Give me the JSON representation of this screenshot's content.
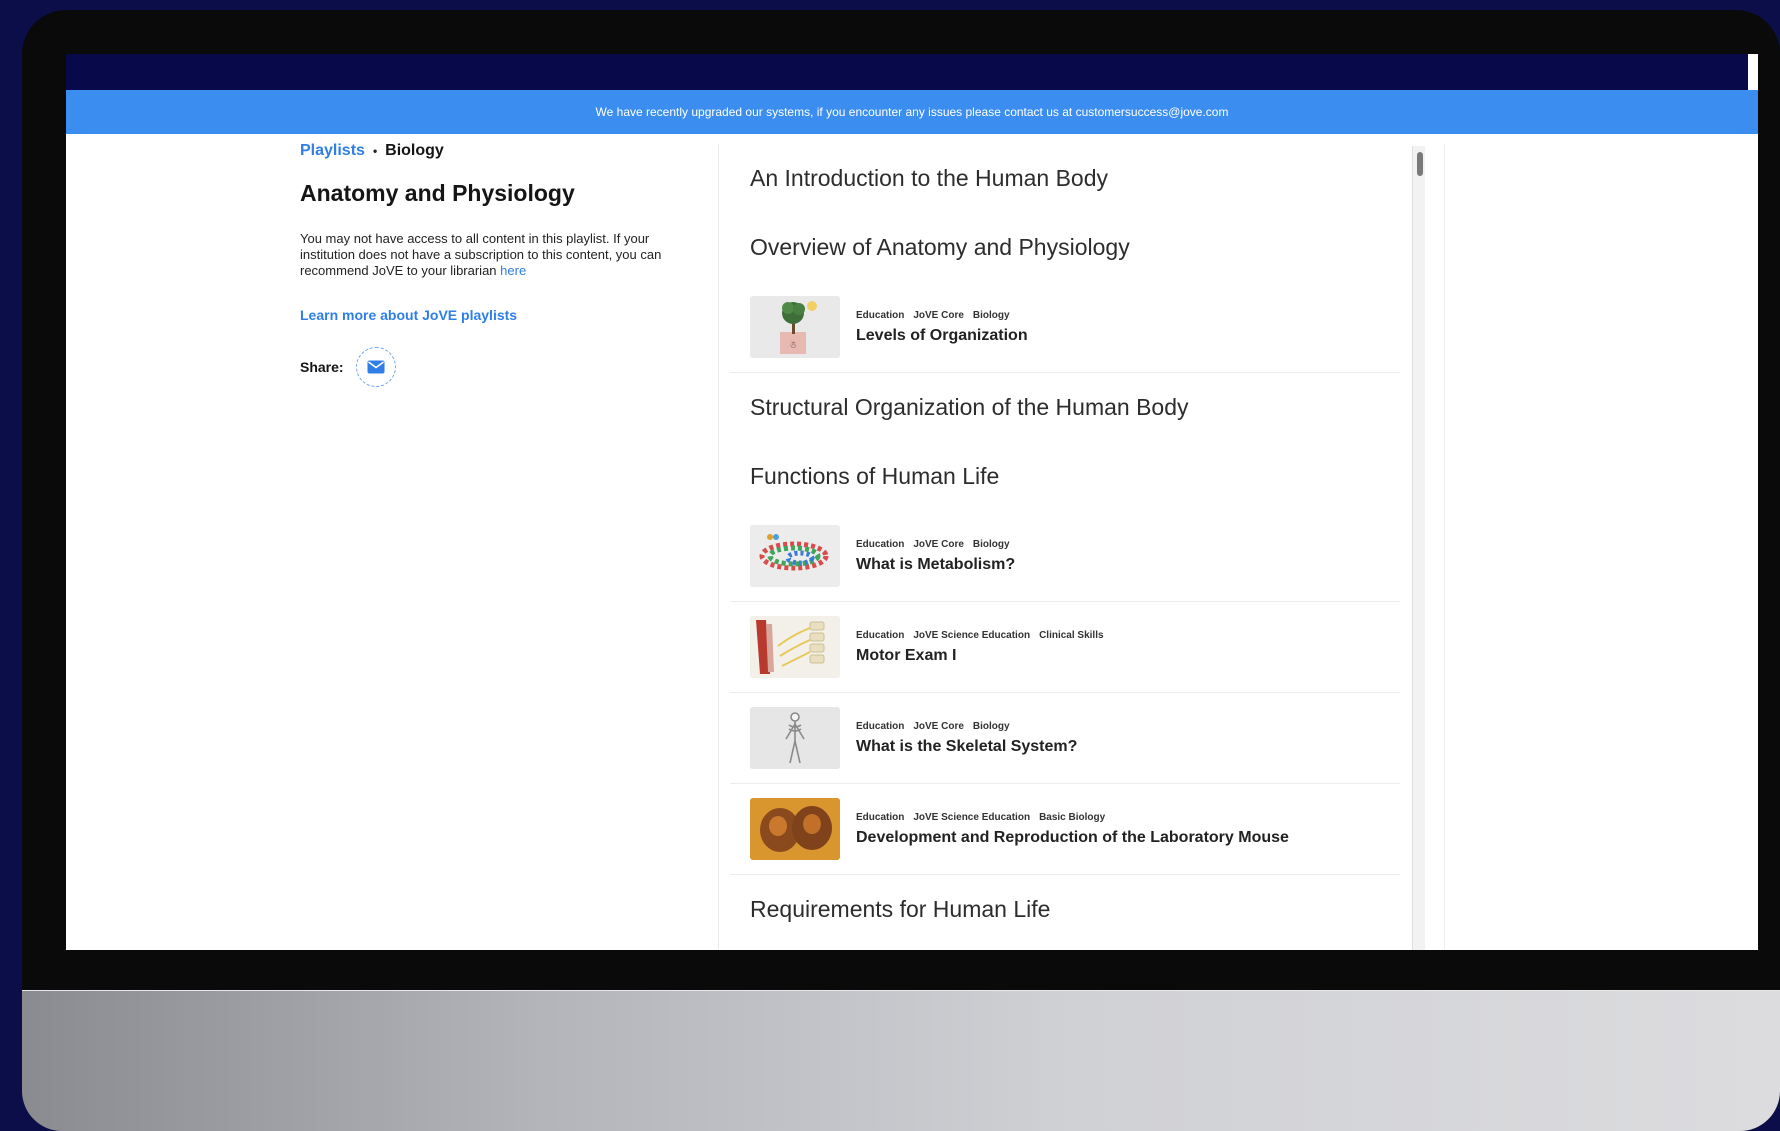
{
  "banner": {
    "message": "We have recently upgraded our systems, if you encounter any issues please contact us at  customersuccess@jove.com"
  },
  "breadcrumb": {
    "parent": "Playlists",
    "separator": "•",
    "current": "Biology"
  },
  "playlist": {
    "title": "Anatomy and Physiology",
    "notice": "You may not have access to all content in this playlist. If your institution does not have a subscription to this content, you can recommend JoVE to your librarian",
    "notice_link": "here",
    "learn_more": "Learn more about JoVE playlists",
    "share_label": "Share:"
  },
  "content": {
    "sections": [
      "An Introduction to the Human Body",
      "Overview of Anatomy and Physiology",
      "Structural Organization of the Human Body",
      "Functions of Human Life",
      "Requirements for Human Life"
    ],
    "items": [
      {
        "tags": [
          "Education",
          "JoVE Core",
          "Biology"
        ],
        "title": "Levels of Organization",
        "thumbnail": "tree-in-pot"
      },
      {
        "tags": [
          "Education",
          "JoVE Core",
          "Biology"
        ],
        "title": "What is Metabolism?",
        "thumbnail": "molecule-chain"
      },
      {
        "tags": [
          "Education",
          "JoVE Science Education",
          "Clinical Skills"
        ],
        "title": "Motor Exam I",
        "thumbnail": "spine-nerves"
      },
      {
        "tags": [
          "Education",
          "JoVE Core",
          "Biology"
        ],
        "title": "What is the Skeletal System?",
        "thumbnail": "skeleton"
      },
      {
        "tags": [
          "Education",
          "JoVE Science Education",
          "Basic Biology"
        ],
        "title": "Development and Reproduction of the Laboratory Mouse",
        "thumbnail": "embryos"
      }
    ]
  },
  "icons": {
    "share": "mail-icon"
  },
  "colors": {
    "banner": "#3b8ef0",
    "link": "#2f7fe6",
    "background": "#0c0e4a"
  }
}
